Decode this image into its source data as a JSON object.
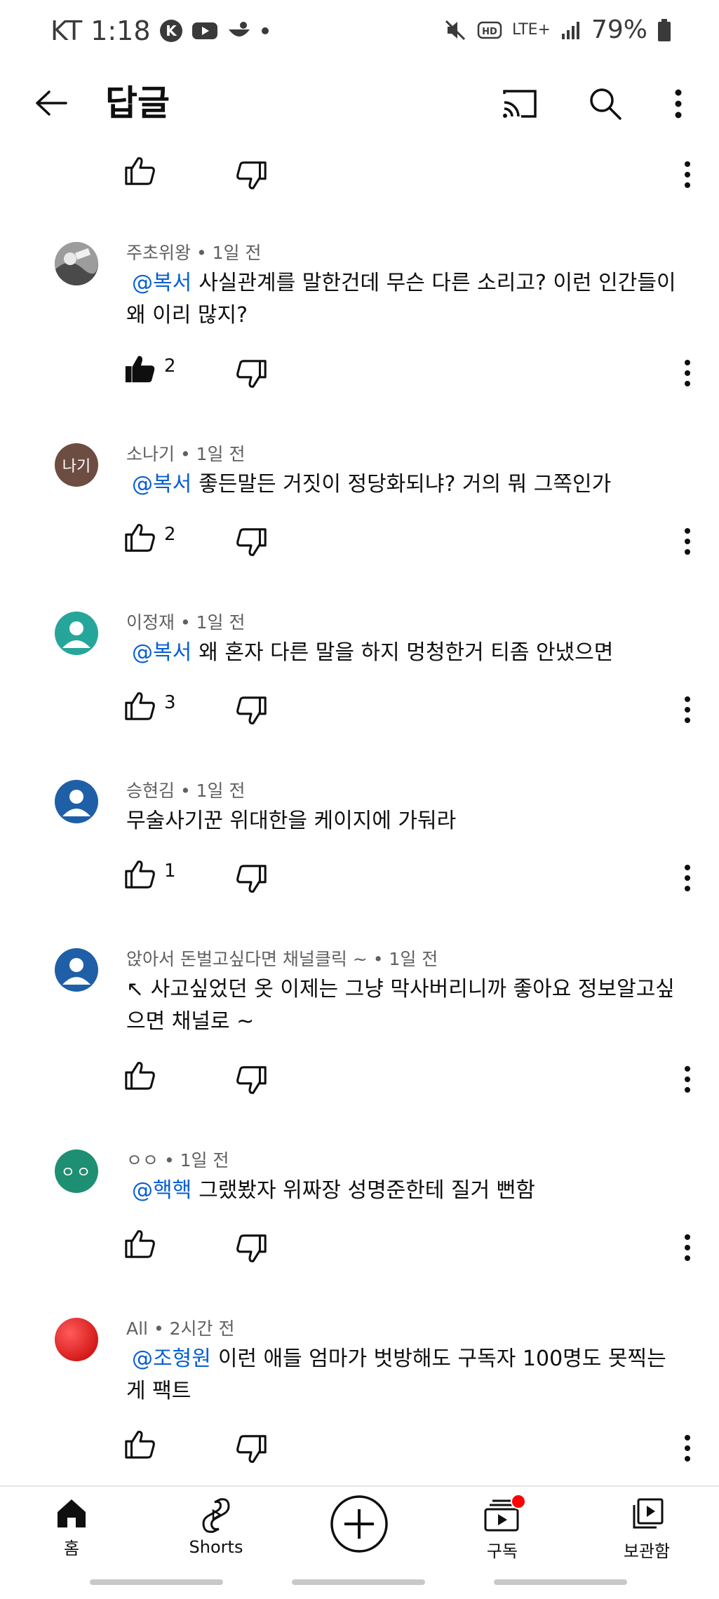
{
  "status_bar": {
    "carrier": "KT",
    "time": "1:18",
    "network": "LTE+",
    "battery": "79%",
    "hd": "HD"
  },
  "header": {
    "title": "답글",
    "icons": [
      "back-arrow-icon",
      "cast-icon",
      "search-icon",
      "more-vert-icon"
    ]
  },
  "comments": [
    {
      "author": "주초위왕 • 1일 전",
      "mention": "@복서",
      "text": "사실관계를 말한건데 무슨 다른 소리고? 이런 인간들이 왜 이리 많지?",
      "likes": "2",
      "liked": true,
      "avatar_color": "#8a8a8a"
    },
    {
      "author": "소나기 • 1일 전",
      "mention": "@복서",
      "text": "좋든말든 거짓이 정당화되냐?  거의 뭐 그쪽인가",
      "likes": "2",
      "liked": false,
      "avatar_text": "나기",
      "avatar_color": "#6d4c41"
    },
    {
      "author": "이정재 • 1일 전",
      "mention": "@복서",
      "text": "왜 혼자 다른 말을 하지 멍청한거 티좀 안냈으면",
      "likes": "3",
      "liked": false,
      "avatar_color": "#26a69a"
    },
    {
      "author": "승현김 • 1일 전",
      "mention": "",
      "text": "무술사기꾼 위대한을 케이지에 가둬라",
      "likes": "1",
      "liked": false,
      "avatar_color": "#1e5fa8"
    },
    {
      "author": "앉아서 돈벌고싶다면 채널클릭 ~ • 1일 전",
      "mention": "",
      "text": "↖ 사고싶었던 옷 이제는 그냥 막사버리니까 좋아요 정보알고싶으면 채널로 ~",
      "likes": "",
      "liked": false,
      "avatar_color": "#1e5fa8"
    },
    {
      "author": "ㅇㅇ • 1일 전",
      "mention": "@핵핵",
      "text": "그랬봤자 위짜장 성명준한테 질거 뻔함",
      "likes": "",
      "liked": false,
      "avatar_text": "ㅇㅇ",
      "avatar_color": "#1e8f72"
    },
    {
      "author": "All • 2시간 전",
      "mention": "@조형원",
      "text": "이런 애들 엄마가 벗방해도 구독자 100명도 못찍는게 팩트",
      "likes": "",
      "liked": false,
      "avatar_color": "#e02020"
    }
  ],
  "top_action_row": {
    "likes": ""
  },
  "bottom_nav": {
    "items": [
      {
        "label": "홈",
        "icon": "home-icon"
      },
      {
        "label": "Shorts",
        "icon": "shorts-icon"
      },
      {
        "label": "",
        "icon": "create-icon"
      },
      {
        "label": "구독",
        "icon": "subscriptions-icon",
        "badge": true
      },
      {
        "label": "보관함",
        "icon": "library-icon"
      }
    ]
  },
  "colors": {
    "mention": "#065fd4",
    "meta": "#606060",
    "badge": "#ff0000"
  }
}
